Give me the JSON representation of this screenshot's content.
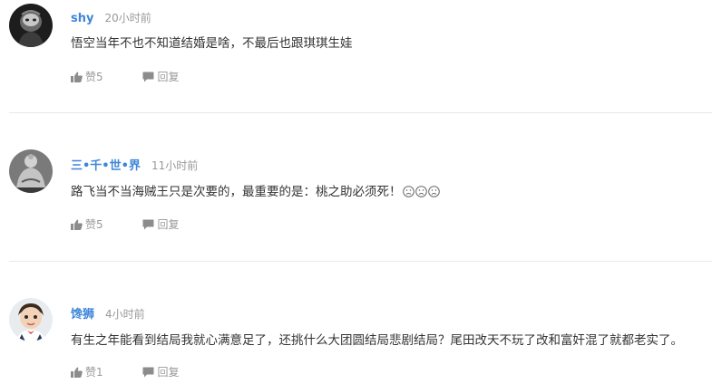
{
  "comments": [
    {
      "avatar_icon": "avatar-monkey-king-icon",
      "username": "shy",
      "time": "20小时前",
      "content": "悟空当年不也不知道结婚是啥，不最后也跟琪琪生娃",
      "like_label": "赞5",
      "reply_label": "回复"
    },
    {
      "avatar_icon": "avatar-buddha-icon",
      "username": "三•千•世•界",
      "time": "11小时前",
      "content": "路飞当不当海贼王只是次要的，最重要的是：桃之助必须死！",
      "emojis": [
        "sad-face-emoji",
        "sad-face-emoji",
        "sad-face-emoji"
      ],
      "like_label": "赞5",
      "reply_label": "回复"
    },
    {
      "avatar_icon": "avatar-baby-boy-icon",
      "username": "馋狮",
      "time": "4小时前",
      "content": "有生之年能看到结局我就心满意足了，还挑什么大团圆结局悲剧结局？尾田改天不玩了改和富奸混了就都老实了。",
      "like_label": "赞1",
      "reply_label": "回复"
    }
  ],
  "colors": {
    "username": "#3f86d9",
    "meta_text": "#999999",
    "content_text": "#333333",
    "divider": "#e8e8e8"
  }
}
